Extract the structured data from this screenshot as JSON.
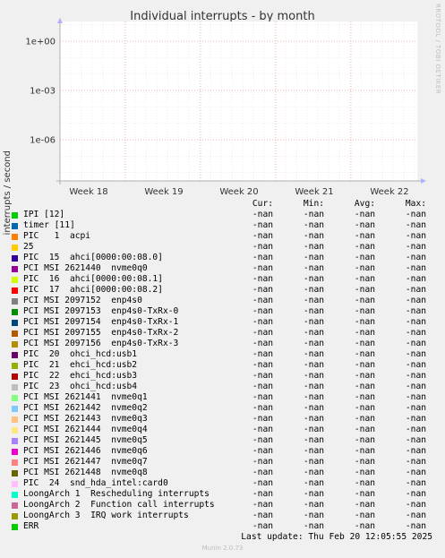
{
  "side_text": "RRDTOOL / TOBI OETIKER",
  "chart_data": {
    "type": "line",
    "title": "Individual interrupts - by month",
    "ylabel": "interrupts / second",
    "y_scale": "log",
    "y_ticks": [
      "1e+00",
      "1e-03",
      "1e-06"
    ],
    "x_ticks": [
      "Week 18",
      "Week 19",
      "Week 20",
      "Week 21",
      "Week 22"
    ],
    "grid": true,
    "columns": [
      "Cur:",
      "Min:",
      "Avg:",
      "Max:"
    ],
    "series": [
      {
        "name": "IPI [12]",
        "color": "#00cc00",
        "cur": "-nan",
        "min": "-nan",
        "avg": "-nan",
        "max": "-nan"
      },
      {
        "name": "timer [11]",
        "color": "#0066b3",
        "cur": "-nan",
        "min": "-nan",
        "avg": "-nan",
        "max": "-nan"
      },
      {
        "name": "PIC   1  acpi",
        "color": "#ff8000",
        "cur": "-nan",
        "min": "-nan",
        "avg": "-nan",
        "max": "-nan"
      },
      {
        "name": "25",
        "color": "#ffcc00",
        "cur": "-nan",
        "min": "-nan",
        "avg": "-nan",
        "max": "-nan"
      },
      {
        "name": "PIC  15  ahci[0000:00:08.0]",
        "color": "#330099",
        "cur": "-nan",
        "min": "-nan",
        "avg": "-nan",
        "max": "-nan"
      },
      {
        "name": "PCI MSI 2621440  nvme0q0",
        "color": "#990099",
        "cur": "-nan",
        "min": "-nan",
        "avg": "-nan",
        "max": "-nan"
      },
      {
        "name": "PIC  16  ahci[0000:00:08.1]",
        "color": "#ccff00",
        "cur": "-nan",
        "min": "-nan",
        "avg": "-nan",
        "max": "-nan"
      },
      {
        "name": "PIC  17  ahci[0000:00:08.2]",
        "color": "#ff0000",
        "cur": "-nan",
        "min": "-nan",
        "avg": "-nan",
        "max": "-nan"
      },
      {
        "name": "PCI MSI 2097152  enp4s0",
        "color": "#808080",
        "cur": "-nan",
        "min": "-nan",
        "avg": "-nan",
        "max": "-nan"
      },
      {
        "name": "PCI MSI 2097153  enp4s0-TxRx-0",
        "color": "#008f00",
        "cur": "-nan",
        "min": "-nan",
        "avg": "-nan",
        "max": "-nan"
      },
      {
        "name": "PCI MSI 2097154  enp4s0-TxRx-1",
        "color": "#00487d",
        "cur": "-nan",
        "min": "-nan",
        "avg": "-nan",
        "max": "-nan"
      },
      {
        "name": "PCI MSI 2097155  enp4s0-TxRx-2",
        "color": "#b35a00",
        "cur": "-nan",
        "min": "-nan",
        "avg": "-nan",
        "max": "-nan"
      },
      {
        "name": "PCI MSI 2097156  enp4s0-TxRx-3",
        "color": "#b38f00",
        "cur": "-nan",
        "min": "-nan",
        "avg": "-nan",
        "max": "-nan"
      },
      {
        "name": "PIC  20  ohci_hcd:usb1",
        "color": "#6b006b",
        "cur": "-nan",
        "min": "-nan",
        "avg": "-nan",
        "max": "-nan"
      },
      {
        "name": "PIC  21  ehci_hcd:usb2",
        "color": "#8fb300",
        "cur": "-nan",
        "min": "-nan",
        "avg": "-nan",
        "max": "-nan"
      },
      {
        "name": "PIC  22  ehci_hcd:usb3",
        "color": "#b30000",
        "cur": "-nan",
        "min": "-nan",
        "avg": "-nan",
        "max": "-nan"
      },
      {
        "name": "PIC  23  ohci_hcd:usb4",
        "color": "#bebebe",
        "cur": "-nan",
        "min": "-nan",
        "avg": "-nan",
        "max": "-nan"
      },
      {
        "name": "PCI MSI 2621441  nvme0q1",
        "color": "#80ff80",
        "cur": "-nan",
        "min": "-nan",
        "avg": "-nan",
        "max": "-nan"
      },
      {
        "name": "PCI MSI 2621442  nvme0q2",
        "color": "#80c9ff",
        "cur": "-nan",
        "min": "-nan",
        "avg": "-nan",
        "max": "-nan"
      },
      {
        "name": "PCI MSI 2621443  nvme0q3",
        "color": "#ffc080",
        "cur": "-nan",
        "min": "-nan",
        "avg": "-nan",
        "max": "-nan"
      },
      {
        "name": "PCI MSI 2621444  nvme0q4",
        "color": "#ffe680",
        "cur": "-nan",
        "min": "-nan",
        "avg": "-nan",
        "max": "-nan"
      },
      {
        "name": "PCI MSI 2621445  nvme0q5",
        "color": "#aa80ff",
        "cur": "-nan",
        "min": "-nan",
        "avg": "-nan",
        "max": "-nan"
      },
      {
        "name": "PCI MSI 2621446  nvme0q6",
        "color": "#ee00cc",
        "cur": "-nan",
        "min": "-nan",
        "avg": "-nan",
        "max": "-nan"
      },
      {
        "name": "PCI MSI 2621447  nvme0q7",
        "color": "#ff8080",
        "cur": "-nan",
        "min": "-nan",
        "avg": "-nan",
        "max": "-nan"
      },
      {
        "name": "PCI MSI 2621448  nvme0q8",
        "color": "#666600",
        "cur": "-nan",
        "min": "-nan",
        "avg": "-nan",
        "max": "-nan"
      },
      {
        "name": "PIC  24  snd_hda_intel:card0",
        "color": "#ffbfff",
        "cur": "-nan",
        "min": "-nan",
        "avg": "-nan",
        "max": "-nan"
      },
      {
        "name": "LoongArch 1  Rescheduling interrupts",
        "color": "#00ffcc",
        "cur": "-nan",
        "min": "-nan",
        "avg": "-nan",
        "max": "-nan"
      },
      {
        "name": "LoongArch 2  Function call interrupts",
        "color": "#cc6699",
        "cur": "-nan",
        "min": "-nan",
        "avg": "-nan",
        "max": "-nan"
      },
      {
        "name": "LoongArch 3  IRQ work interrupts",
        "color": "#999900",
        "cur": "-nan",
        "min": "-nan",
        "avg": "-nan",
        "max": "-nan"
      },
      {
        "name": "ERR",
        "color": "#00cc00",
        "cur": "-nan",
        "min": "-nan",
        "avg": "-nan",
        "max": "-nan"
      }
    ]
  },
  "last_update": "Last update: Thu Feb 20 12:05:55 2025",
  "footer": "Munin 2.0.73"
}
